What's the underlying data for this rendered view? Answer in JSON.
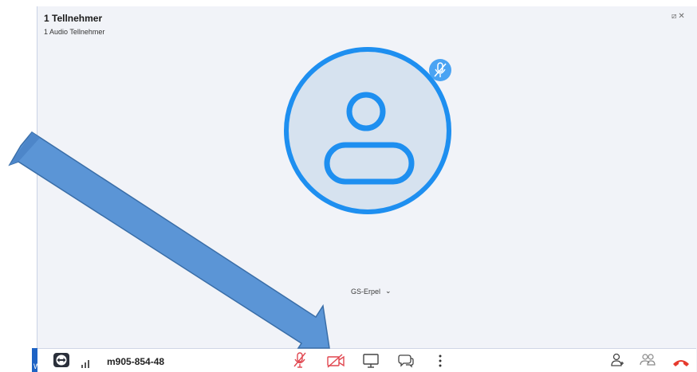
{
  "header": {
    "title": "1 Tellnehmer",
    "subtitle": "1 Audio Tellnehmer",
    "controls": [
      "⧄",
      "✕"
    ]
  },
  "participant": {
    "name": "GS-Erpel",
    "dropdown_icon": "chevron-down-icon"
  },
  "toolbar": {
    "meeting_code": "m905-854-48",
    "left_accent_label": "W",
    "icons": [
      "teamviewer-logo-icon",
      "signal-strength-icon",
      "microphone-muted-icon",
      "camera-off-icon",
      "screen-share-icon",
      "chat-icon",
      "more-options-icon",
      "add-participant-icon",
      "participants-icon",
      "hang-up-icon"
    ]
  },
  "colors": {
    "accent": "#1e8ff0",
    "avatar_fill": "#d6e2ef",
    "muted_red": "#e0464f",
    "hangup_red": "#e63b2e",
    "arrow_fill": "#5b95d6",
    "arrow_stroke": "#3a6ea8"
  }
}
